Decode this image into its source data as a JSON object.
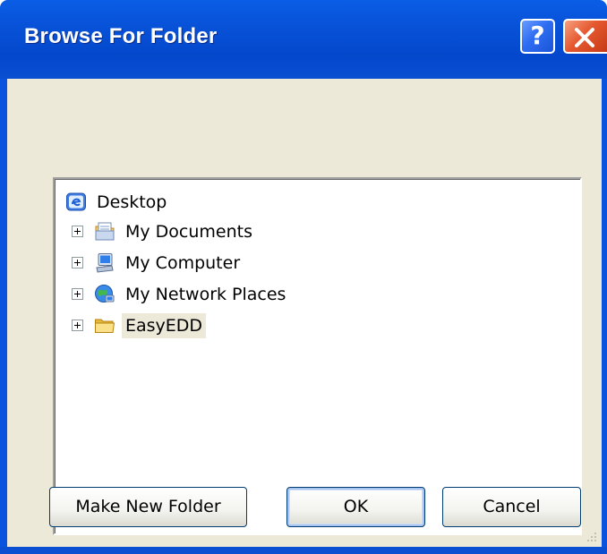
{
  "window": {
    "title": "Browse For Folder",
    "help_label": "?"
  },
  "tree": {
    "root": {
      "label": "Desktop",
      "icon": "desktop-icon"
    },
    "items": [
      {
        "label": "My Documents",
        "icon": "my-documents-icon",
        "expandable": true
      },
      {
        "label": "My Computer",
        "icon": "my-computer-icon",
        "expandable": true
      },
      {
        "label": "My Network Places",
        "icon": "network-places-icon",
        "expandable": true
      },
      {
        "label": "EasyEDD",
        "icon": "folder-icon",
        "expandable": true,
        "selected": true
      }
    ]
  },
  "buttons": {
    "make_new_folder": "Make New Folder",
    "ok": "OK",
    "cancel": "Cancel"
  },
  "colors": {
    "titlebar": "#0a53de",
    "client": "#ece9d8",
    "close": "#e5582f",
    "selection": "#ece9d8"
  }
}
